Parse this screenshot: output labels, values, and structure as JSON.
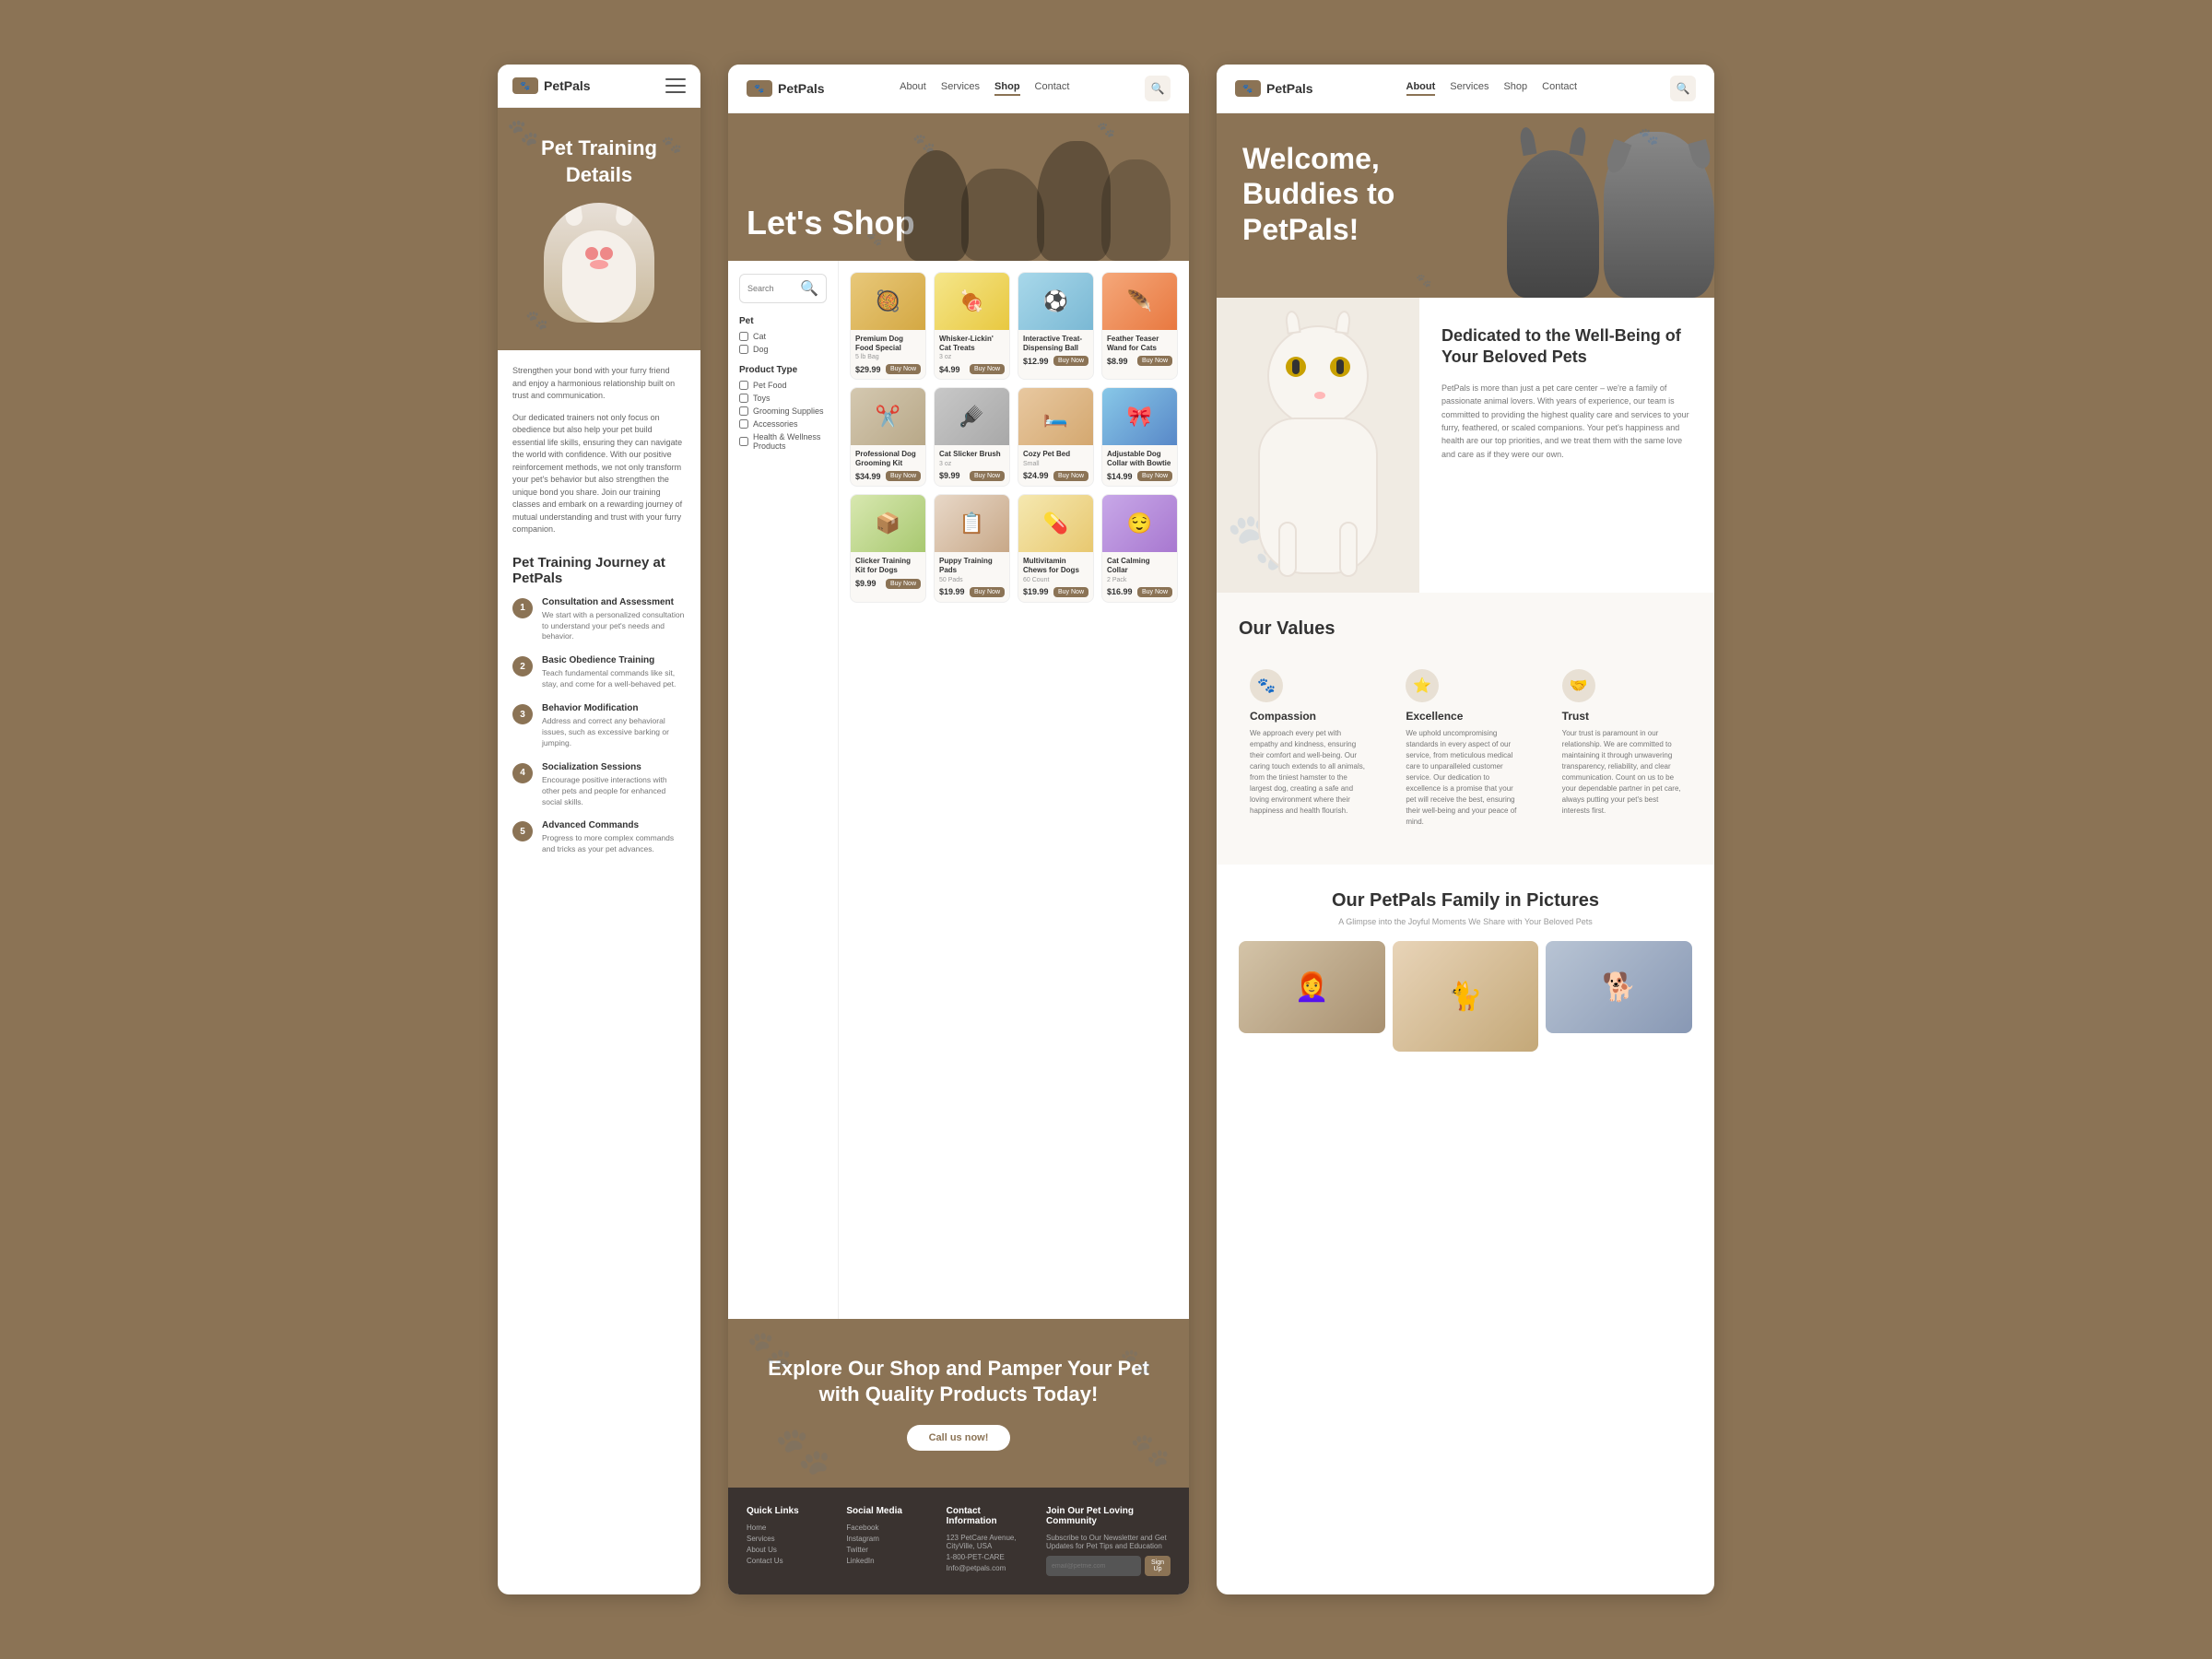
{
  "brand": {
    "name": "PetPals",
    "logo_text": "🐾"
  },
  "nav": {
    "about": "About",
    "services": "Services",
    "shop": "Shop",
    "contact": "Contact"
  },
  "panel_mobile": {
    "title": "Pet Training Details",
    "intro_text": "Strengthen your bond with your furry friend and enjoy a harmonious relationship built on trust and communication.",
    "body_text": "Our dedicated trainers not only focus on obedience but also help your pet build essential life skills, ensuring they can navigate the world with confidence. With our positive reinforcement methods, we not only transform your pet's behavior but also strengthen the unique bond you share. Join our training classes and embark on a rewarding journey of mutual understanding and trust with your furry companion.",
    "journey_title": "Pet Training Journey at PetPals",
    "steps": [
      {
        "number": "1",
        "title": "Consultation and Assessment",
        "desc": "We start with a personalized consultation to understand your pet's needs and behavior."
      },
      {
        "number": "2",
        "title": "Basic Obedience Training",
        "desc": "Teach fundamental commands like sit, stay, and come for a well-behaved pet."
      },
      {
        "number": "3",
        "title": "Behavior Modification",
        "desc": "Address and correct any behavioral issues, such as excessive barking or jumping."
      },
      {
        "number": "4",
        "title": "Socialization Sessions",
        "desc": "Encourage positive interactions with other pets and people for enhanced social skills."
      },
      {
        "number": "5",
        "title": "Advanced Commands",
        "desc": "Progress to more complex commands and tricks as your pet advances."
      }
    ]
  },
  "panel_shop": {
    "hero_title": "Let's Shop",
    "search_placeholder": "Search",
    "filter_pet_label": "Pet",
    "filter_cat": "Cat",
    "filter_dog": "Dog",
    "filter_product_type_label": "Product Type",
    "filter_options": [
      "Pet Food",
      "Toys",
      "Grooming Supplies",
      "Accessories",
      "Health & Wellness Products"
    ],
    "products": [
      {
        "name": "Premium Dog Food Special",
        "size": "5 lb Bag",
        "price": "$29.99",
        "emoji": "🥘",
        "bg": "prod-dog-food",
        "buy": "Buy Now"
      },
      {
        "name": "Whisker-Lickin' Cat Treats",
        "size": "3 oz",
        "price": "$4.99",
        "emoji": "🍖",
        "bg": "prod-cat-treat",
        "buy": "Buy Now"
      },
      {
        "name": "Interactive Treat-Dispensing Ball",
        "size": "",
        "price": "$12.99",
        "emoji": "⚽",
        "bg": "prod-ball",
        "buy": "Buy Now"
      },
      {
        "name": "Feather Teaser Wand for Cats",
        "size": "",
        "price": "$8.99",
        "emoji": "🪶",
        "bg": "prod-feather",
        "buy": "Buy Now"
      },
      {
        "name": "Professional Dog Grooming Kit",
        "size": "",
        "price": "$34.99",
        "emoji": "✂️",
        "bg": "prod-groom",
        "buy": "Buy Now"
      },
      {
        "name": "Cat Slicker Brush",
        "size": "3 oz",
        "price": "$9.99",
        "emoji": "🪮",
        "bg": "prod-slicker",
        "buy": "Buy Now"
      },
      {
        "name": "Cozy Pet Bed",
        "size": "Small",
        "price": "$24.99",
        "emoji": "🛏️",
        "bg": "prod-cozy",
        "buy": "Buy Now"
      },
      {
        "name": "Adjustable Dog Collar with Bowtie",
        "size": "",
        "price": "$14.99",
        "emoji": "🎀",
        "bg": "prod-collar",
        "buy": "Buy Now"
      },
      {
        "name": "Clicker Training Kit for Dogs",
        "size": "",
        "price": "$9.99",
        "emoji": "📦",
        "bg": "prod-clicker",
        "buy": "Buy Now"
      },
      {
        "name": "Puppy Training Pads",
        "size": "50 Pads",
        "price": "$19.99",
        "emoji": "📋",
        "bg": "prod-pads",
        "buy": "Buy Now"
      },
      {
        "name": "Multivitamin Chews for Dogs",
        "size": "60 Count",
        "price": "$19.99",
        "emoji": "💊",
        "bg": "prod-chews",
        "buy": "Buy Now"
      },
      {
        "name": "Cat Calming Collar",
        "size": "2 Pack",
        "price": "$16.99",
        "emoji": "😌",
        "bg": "prod-calm",
        "buy": "Buy Now"
      }
    ],
    "cta_title": "Explore Our Shop and Pamper Your Pet with Quality Products Today!",
    "cta_button": "Call us now!",
    "footer": {
      "quick_links_title": "Quick Links",
      "quick_links": [
        "Home",
        "Services",
        "About Us",
        "Contact Us"
      ],
      "social_title": "Social Media",
      "social_links": [
        "Facebook",
        "Instagram",
        "Twitter",
        "LinkedIn"
      ],
      "contact_title": "Contact Information",
      "address": "123 PetCare Avenue, CityVille, USA",
      "phone": "1-800-PET-CARE",
      "email": "Info@petpals.com",
      "community_title": "Join Our Pet Loving Community",
      "community_text": "Subscribe to Our Newsletter and Get Updates for Pet Tips and Education",
      "email_placeholder": "email@petme.com",
      "signup_button": "Sign Up"
    }
  },
  "panel_about": {
    "hero_title": "Welcome, Buddies to PetPals!",
    "dedicated_title": "Dedicated to the Well-Being of Your Beloved Pets",
    "dedicated_text": "PetPals is more than just a pet care center – we're a family of passionate animal lovers. With years of experience, our team is committed to providing the highest quality care and services to your furry, feathered, or scaled companions. Your pet's happiness and health are our top priorities, and we treat them with the same love and care as if they were our own.",
    "values_title": "Our Values",
    "values": [
      {
        "name": "Compassion",
        "icon": "🐾",
        "desc": "We approach every pet with empathy and kindness, ensuring their comfort and well-being. Our caring touch extends to all animals, from the tiniest hamster to the largest dog, creating a safe and loving environment where their happiness and health flourish."
      },
      {
        "name": "Excellence",
        "icon": "⭐",
        "desc": "We uphold uncompromising standards in every aspect of our service, from meticulous medical care to unparalleled customer service. Our dedication to excellence is a promise that your pet will receive the best, ensuring their well-being and your peace of mind."
      },
      {
        "name": "Trust",
        "icon": "🤝",
        "desc": "Your trust is paramount in our relationship. We are committed to maintaining it through unwavering transparency, reliability, and clear communication. Count on us to be your dependable partner in pet care, always putting your pet's best interests first."
      }
    ],
    "gallery_title": "Our PetPals Family in Pictures",
    "gallery_subtitle": "A Glimpse into the Joyful Moments We Share with Your Beloved Pets"
  }
}
